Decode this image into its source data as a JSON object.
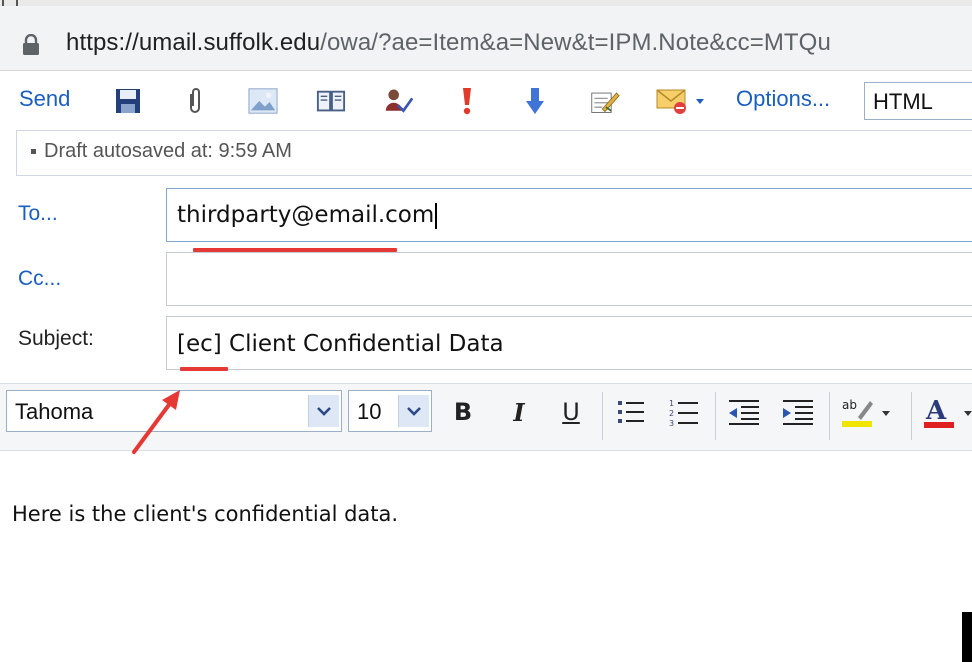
{
  "browser": {
    "url_host": "https://umail.suffolk.edu",
    "url_path": "/owa/?ae=Item&a=New&t=IPM.Note&cc=MTQu"
  },
  "toolbar": {
    "send_label": "Send",
    "options_label": "Options...",
    "format_value": "HTML",
    "icons": [
      "save-icon",
      "attach-icon",
      "insert-image-icon",
      "address-book-icon",
      "check-names-icon",
      "high-importance-icon",
      "low-importance-icon",
      "spell-check-icon",
      "message-flag-icon"
    ]
  },
  "infobar": {
    "text": "Draft autosaved at: 9:59 AM"
  },
  "fields": {
    "to_label": "To...",
    "to_value": "thirdparty@email.com",
    "cc_label": "Cc...",
    "cc_value": "",
    "subject_label": "Subject:",
    "subject_value": "[ec] Client Confidential Data"
  },
  "formatting": {
    "font_name": "Tahoma",
    "font_size": "10",
    "bold": "B",
    "italic": "I",
    "underline": "U",
    "font_color_glyph": "A"
  },
  "message": {
    "body": "Here is the client's confidential data."
  },
  "colors": {
    "link_blue": "#1a5fbf",
    "annotation_red": "#e53935"
  }
}
